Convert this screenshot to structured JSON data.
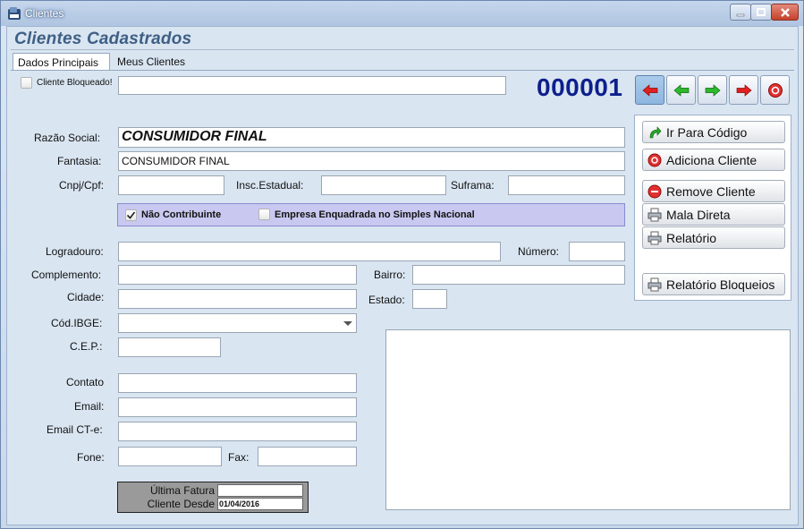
{
  "window": {
    "title": "Clientes"
  },
  "header": {
    "title": "Clientes Cadastrados"
  },
  "tabs": [
    {
      "label": "Dados Principais"
    },
    {
      "label": "Meus Clientes"
    }
  ],
  "top": {
    "blocked_label": "Cliente Bloqueado!",
    "blocked_value": "",
    "code": "000001"
  },
  "nav": [
    "first",
    "prev",
    "next",
    "last",
    "cancel"
  ],
  "side": {
    "goto_label": "Ir Para Código",
    "add_label": "Adiciona Cliente",
    "remove_label": "Remove Cliente",
    "mail_label": "Mala Direta",
    "report_label": "Relatório",
    "report_block_label": "Relatório Bloqueios"
  },
  "form": {
    "razao_label": "Razão Social:",
    "razao_value": "CONSUMIDOR FINAL",
    "fantasia_label": "Fantasia:",
    "fantasia_value": "CONSUMIDOR FINAL",
    "cnpj_label": "Cnpj/Cpf:",
    "cnpj_value": "",
    "ie_label": "Insc.Estadual:",
    "ie_value": "",
    "suframa_label": "Suframa:",
    "suframa_value": "",
    "nao_contrib_label": "Não Contribuinte",
    "nao_contrib_checked": true,
    "simples_label": "Empresa Enquadrada no Simples Nacional",
    "simples_checked": false,
    "logradouro_label": "Logradouro:",
    "logradouro_value": "",
    "numero_label": "Número:",
    "numero_value": "",
    "complemento_label": "Complemento:",
    "complemento_value": "",
    "bairro_label": "Bairro:",
    "bairro_value": "",
    "cidade_label": "Cidade:",
    "cidade_value": "",
    "estado_label": "Estado:",
    "estado_value": "",
    "ibge_label": "Cód.IBGE:",
    "ibge_value": "",
    "cep_label": "C.E.P.:",
    "cep_value": "",
    "contato_label": "Contato",
    "contato_value": "",
    "email_label": "Email:",
    "email_value": "",
    "emailcte_label": "Email CT-e:",
    "emailcte_value": "",
    "fone_label": "Fone:",
    "fone_value": "",
    "fax_label": "Fax:",
    "fax_value": ""
  },
  "info": {
    "ultima_label": "Última Fatura",
    "ultima_value": "",
    "desde_label": "Cliente Desde",
    "desde_value": "01/04/2016"
  },
  "colors": {
    "code": "#0e1f8c",
    "header": "#3e5f85",
    "options_bg": "#c8c8f0"
  }
}
